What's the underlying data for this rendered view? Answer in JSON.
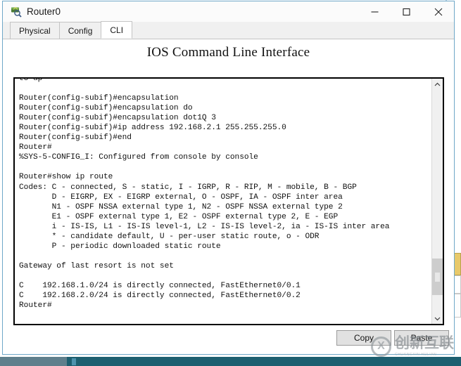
{
  "window": {
    "title": "Router0",
    "icon": "router-icon",
    "controls": {
      "minimize": "minimize-icon",
      "maximize": "maximize-icon",
      "close": "close-icon"
    }
  },
  "tabs": [
    {
      "label": "Physical",
      "active": false
    },
    {
      "label": "Config",
      "active": false
    },
    {
      "label": "CLI",
      "active": true
    }
  ],
  "panel": {
    "title": "IOS Command Line Interface"
  },
  "terminal": {
    "text": "to up\n\nRouter(config-subif)#encapsulation\nRouter(config-subif)#encapsulation do\nRouter(config-subif)#encapsulation dot1Q 3\nRouter(config-subif)#ip address 192.168.2.1 255.255.255.0\nRouter(config-subif)#end\nRouter#\n%SYS-5-CONFIG_I: Configured from console by console\n\nRouter#show ip route\nCodes: C - connected, S - static, I - IGRP, R - RIP, M - mobile, B - BGP\n       D - EIGRP, EX - EIGRP external, O - OSPF, IA - OSPF inter area\n       N1 - OSPF NSSA external type 1, N2 - OSPF NSSA external type 2\n       E1 - OSPF external type 1, E2 - OSPF external type 2, E - EGP\n       i - IS-IS, L1 - IS-IS level-1, L2 - IS-IS level-2, ia - IS-IS inter area\n       * - candidate default, U - per-user static route, o - ODR\n       P - periodic downloaded static route\n\nGateway of last resort is not set\n\nC    192.168.1.0/24 is directly connected, FastEthernet0/0.1\nC    192.168.2.0/24 is directly connected, FastEthernet0/0.2\nRouter#"
  },
  "scrollbar": {
    "up_arrow": "chevron-up-icon",
    "down_arrow": "chevron-down-icon"
  },
  "buttons": {
    "copy": "Copy",
    "paste": "Paste"
  },
  "watermark": {
    "text": "创新互联",
    "subtext": "CHUANGXIN HULIAN"
  },
  "colors": {
    "window_border": "#6fa8c8",
    "terminal_border": "#000000",
    "taskbar": "#1d5f70",
    "accent_yellow": "#e8c96a"
  }
}
